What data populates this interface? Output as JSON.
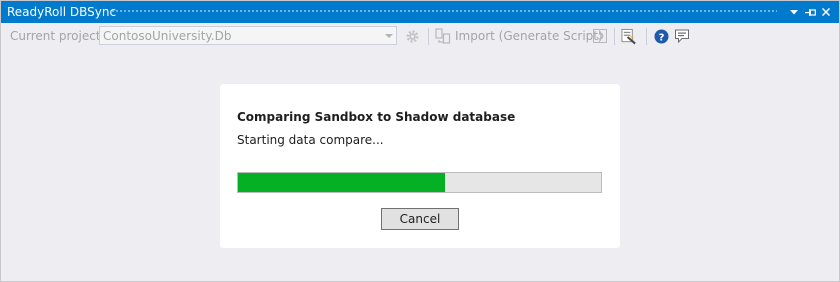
{
  "window": {
    "title": "ReadyRoll DBSync",
    "controls": {
      "menu_icon": "dropdown-arrow-icon",
      "pin_icon": "pin-icon",
      "close_icon": "close-icon"
    }
  },
  "toolbar": {
    "project_label": "Current project:",
    "project_value": "ContosoUniversity.Db",
    "settings_icon": "gear-icon",
    "import_icon": "import-icon",
    "import_label": "Import (Generate Script)",
    "refresh_icon": "refresh-icon",
    "tools_icon": "tools-icon",
    "help_icon": "help-icon",
    "feedback_icon": "feedback-icon"
  },
  "dialog": {
    "title": "Comparing Sandbox to Shadow database",
    "status": "Starting data compare...",
    "progress_fraction": 0.57,
    "cancel_label": "Cancel"
  },
  "colors": {
    "title_bar": "#007acc",
    "progress_fill": "#06b025",
    "progress_track": "#e6e6e6",
    "background": "#eeeef2"
  }
}
